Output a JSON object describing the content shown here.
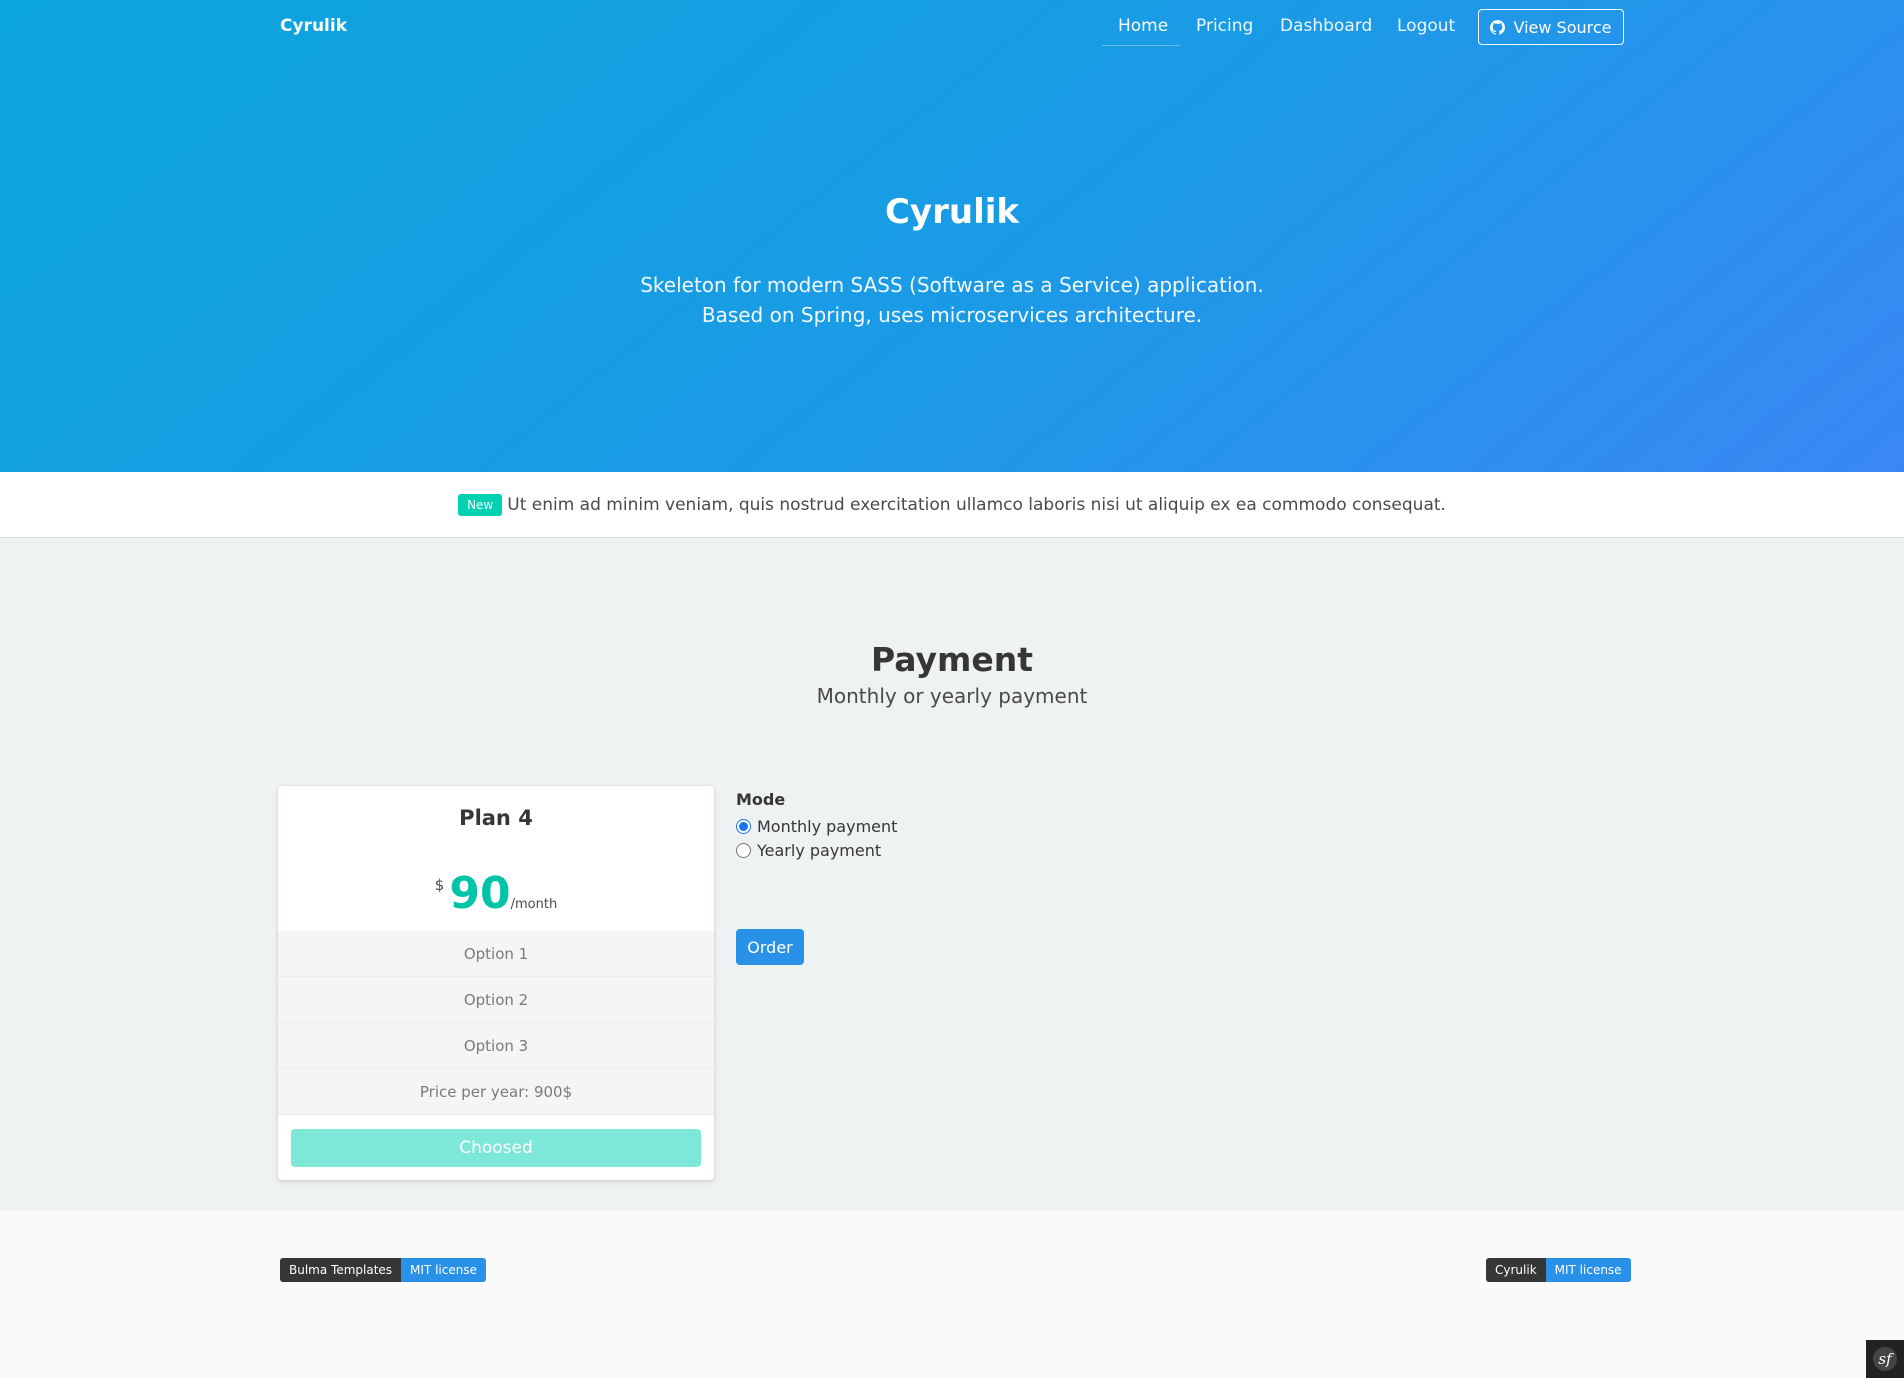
{
  "nav": {
    "brand": "Cyrulik",
    "items": [
      {
        "label": "Home",
        "active": true
      },
      {
        "label": "Pricing"
      },
      {
        "label": "Dashboard"
      },
      {
        "label": "Logout"
      }
    ],
    "source_button": "View Source",
    "source_icon": "github-icon"
  },
  "hero": {
    "title": "Cyrulik",
    "subtitle_line1": "Skeleton for modern SASS (Software as a Service) application.",
    "subtitle_line2": "Based on Spring, uses microservices architecture.",
    "gradient": [
      "#0aa5dc",
      "#3a87f4"
    ]
  },
  "announcement": {
    "tag": "New",
    "text": "Ut enim ad minim veniam, quis nostrud exercitation ullamco laboris nisi ut aliquip ex ea commodo consequat."
  },
  "payment": {
    "title": "Payment",
    "subtitle": "Monthly or yearly payment"
  },
  "plan": {
    "name": "Plan 4",
    "currency": "$",
    "amount": "90",
    "period": "/month",
    "options": [
      "Option 1",
      "Option 2",
      "Option 3",
      "Price per year: 900$"
    ],
    "button": "Choosed",
    "accent": "#00c4a7"
  },
  "mode": {
    "label": "Mode",
    "options": [
      {
        "label": "Monthly payment",
        "checked": true
      },
      {
        "label": "Yearly payment",
        "checked": false
      }
    ],
    "order_button": "Order"
  },
  "footer": {
    "left_badge": {
      "left": "Bulma Templates",
      "right": "MIT license"
    },
    "right_badge": {
      "left": "Cyrulik",
      "right": "MIT license"
    },
    "toolbar_icon": "symfony-icon",
    "toolbar_glyph": "sf"
  }
}
